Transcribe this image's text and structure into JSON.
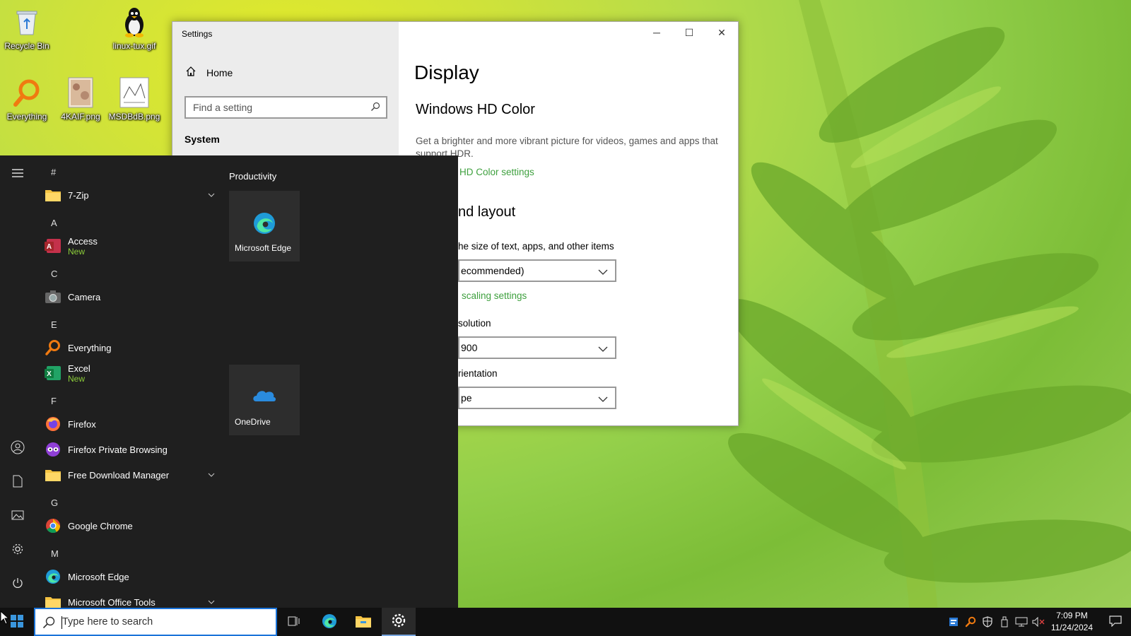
{
  "desktop": {
    "icons": [
      {
        "label": "Recycle Bin",
        "icon": "recycle-bin-icon"
      },
      {
        "label": "linux-tux.gif",
        "icon": "tux-icon"
      },
      {
        "label": "Everything",
        "icon": "everything-search-icon"
      },
      {
        "label": "4KAIF.png",
        "icon": "image-file-icon"
      },
      {
        "label": "MSDBdB.png",
        "icon": "image-file-icon"
      }
    ]
  },
  "settings": {
    "window_title": "Settings",
    "home_label": "Home",
    "search_placeholder": "Find a setting",
    "section_label": "System",
    "page_title": "Display",
    "hd_title": "Windows HD Color",
    "hd_desc": "Get a brighter and more vibrant picture for videos, games and apps that support HDR.",
    "hd_link": "HD Color settings",
    "layout_title": "nd layout",
    "scale_label": "he size of text, apps, and other items",
    "scale_value": "ecommended)",
    "scaling_link": "scaling settings",
    "resolution_label": "solution",
    "resolution_value": "900",
    "orientation_label": "rientation",
    "orientation_value": "pe"
  },
  "start_menu": {
    "letters": [
      "#",
      "A",
      "C",
      "E",
      "F",
      "G",
      "M"
    ],
    "apps": [
      {
        "name": "7-Zip",
        "sub": "",
        "icon": "folder-icon"
      },
      {
        "name": "Access",
        "sub": "New",
        "icon": "access-icon"
      },
      {
        "name": "Camera",
        "sub": "",
        "icon": "camera-icon"
      },
      {
        "name": "Everything",
        "sub": "",
        "icon": "everything-search-icon"
      },
      {
        "name": "Excel",
        "sub": "New",
        "icon": "excel-icon"
      },
      {
        "name": "Firefox",
        "sub": "",
        "icon": "firefox-icon"
      },
      {
        "name": "Firefox Private Browsing",
        "sub": "",
        "icon": "firefox-private-icon"
      },
      {
        "name": "Free Download Manager",
        "sub": "",
        "icon": "folder-icon"
      },
      {
        "name": "Google Chrome",
        "sub": "",
        "icon": "chrome-icon"
      },
      {
        "name": "Microsoft Edge",
        "sub": "",
        "icon": "edge-icon"
      },
      {
        "name": "Microsoft Office Tools",
        "sub": "",
        "icon": "folder-icon"
      }
    ],
    "tiles_group": "Productivity",
    "tiles": [
      {
        "name": "Microsoft Edge",
        "icon": "edge-icon"
      },
      {
        "name": "OneDrive",
        "icon": "onedrive-icon"
      }
    ]
  },
  "taskbar": {
    "search_placeholder": "Type here to search",
    "time": "7:09 PM",
    "date": "11/24/2024"
  },
  "colors": {
    "accent_link": "#3ea03e",
    "new_badge": "#8dce3a",
    "start_bg": "#1f1f1f",
    "taskbar_bg": "#111111"
  }
}
